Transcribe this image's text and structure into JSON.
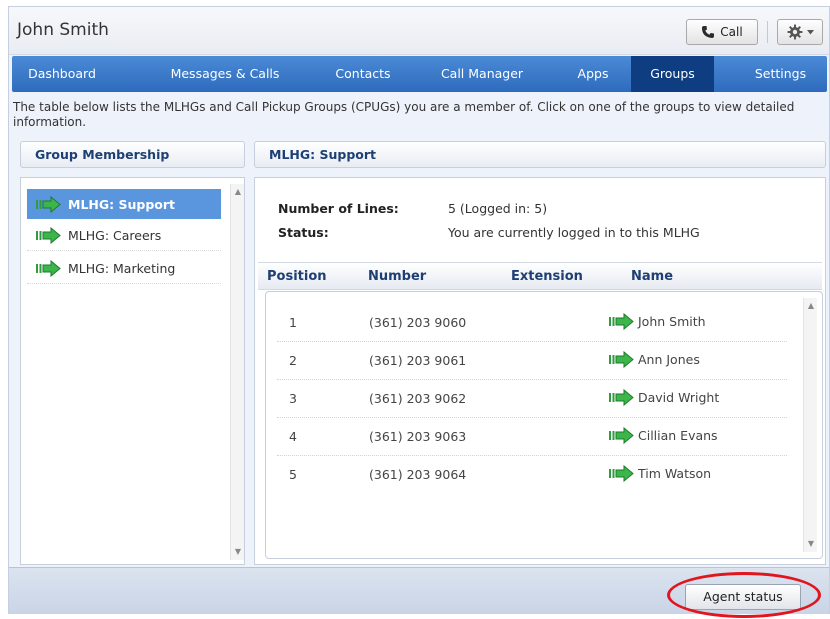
{
  "window": {
    "title": "John Smith"
  },
  "toolbar": {
    "call_label": "Call"
  },
  "nav": {
    "tabs": [
      {
        "label": "Dashboard"
      },
      {
        "label": "Messages & Calls"
      },
      {
        "label": "Contacts"
      },
      {
        "label": "Call Manager"
      },
      {
        "label": "Apps"
      },
      {
        "label": "Groups",
        "active": true
      },
      {
        "label": "Settings"
      }
    ]
  },
  "intro": "The table below lists the MLHGs and Call Pickup Groups (CPUGs) you are a member of. Click on one of the groups to view detailed information.",
  "left_panel": {
    "header": "Group Membership",
    "groups": [
      {
        "label": "MLHG: Support",
        "selected": true
      },
      {
        "label": "MLHG: Careers"
      },
      {
        "label": "MLHG: Marketing"
      }
    ]
  },
  "right_panel": {
    "header": "MLHG: Support",
    "lines_label": "Number of Lines:",
    "lines_value": "5  (Logged in: 5)",
    "status_label": "Status:",
    "status_value": "You are currently logged in to this MLHG",
    "columns": [
      "Position",
      "Number",
      "Extension",
      "Name"
    ],
    "members": [
      {
        "position": "1",
        "number": "(361) 203 9060",
        "extension": "",
        "name": "John Smith"
      },
      {
        "position": "2",
        "number": "(361) 203 9061",
        "extension": "",
        "name": "Ann Jones"
      },
      {
        "position": "3",
        "number": "(361) 203 9062",
        "extension": "",
        "name": "David Wright"
      },
      {
        "position": "4",
        "number": "(361) 203 9063",
        "extension": "",
        "name": "Cillian Evans"
      },
      {
        "position": "5",
        "number": "(361) 203 9064",
        "extension": "",
        "name": "Tim Watson"
      }
    ]
  },
  "footer": {
    "agent_status_label": "Agent status"
  },
  "colors": {
    "nav": "#2e6bbd",
    "nav_active": "#0e3d82",
    "selected": "#5a96de",
    "highlight": "#e0151d",
    "logged_in_icon": "#3cb64a"
  }
}
